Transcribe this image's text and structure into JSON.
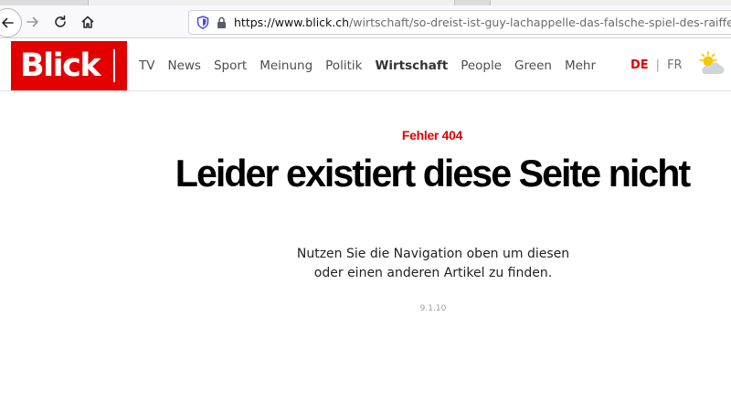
{
  "browser": {
    "url_host": "https://www.blick.ch",
    "url_path": "/wirtschaft/so-dreist-ist-guy-lachappelle-das-falsche-spiel-des-raiffeisen-pra"
  },
  "header": {
    "logo_text": "Blick",
    "nav": [
      {
        "label": "TV",
        "active": false
      },
      {
        "label": "News",
        "active": false
      },
      {
        "label": "Sport",
        "active": false
      },
      {
        "label": "Meinung",
        "active": false
      },
      {
        "label": "Politik",
        "active": false
      },
      {
        "label": "Wirtschaft",
        "active": true
      },
      {
        "label": "People",
        "active": false
      },
      {
        "label": "Green",
        "active": false
      },
      {
        "label": "Mehr",
        "active": false
      }
    ],
    "lang_active": "DE",
    "lang_sep": "|",
    "lang_other": "FR",
    "weather_icon": "sun-cloud-icon"
  },
  "error": {
    "code": "Fehler 404",
    "title": "Leider existiert diese Seite nicht",
    "line1": "Nutzen Sie die Navigation oben um diesen",
    "line2": "oder einen anderen Artikel zu finden.",
    "version": "9.1.10"
  },
  "colors": {
    "brand_red": "#e20000",
    "text_dark": "#000000",
    "nav_grey": "#4d4d4d"
  }
}
